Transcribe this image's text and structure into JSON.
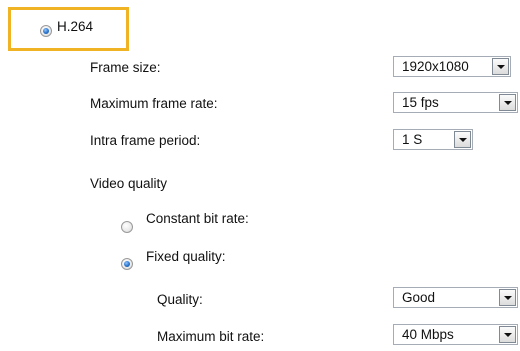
{
  "codec": {
    "label": "H.264",
    "selected": true
  },
  "frame_size": {
    "label": "Frame size:",
    "value": "1920x1080"
  },
  "max_frame_rate": {
    "label": "Maximum frame rate:",
    "value": "15 fps"
  },
  "intra_frame_period": {
    "label": "Intra frame period:",
    "value": "1 S"
  },
  "video_quality": {
    "heading": "Video quality",
    "constant_bit_rate": {
      "label": "Constant bit rate:",
      "selected": false
    },
    "fixed_quality": {
      "label": "Fixed quality:",
      "selected": true
    },
    "quality": {
      "label": "Quality:",
      "value": "Good"
    },
    "max_bit_rate": {
      "label": "Maximum bit rate:",
      "value": "40 Mbps"
    }
  },
  "colors": {
    "highlight": "#f0b323",
    "radio_selected": "#2a73c9"
  }
}
